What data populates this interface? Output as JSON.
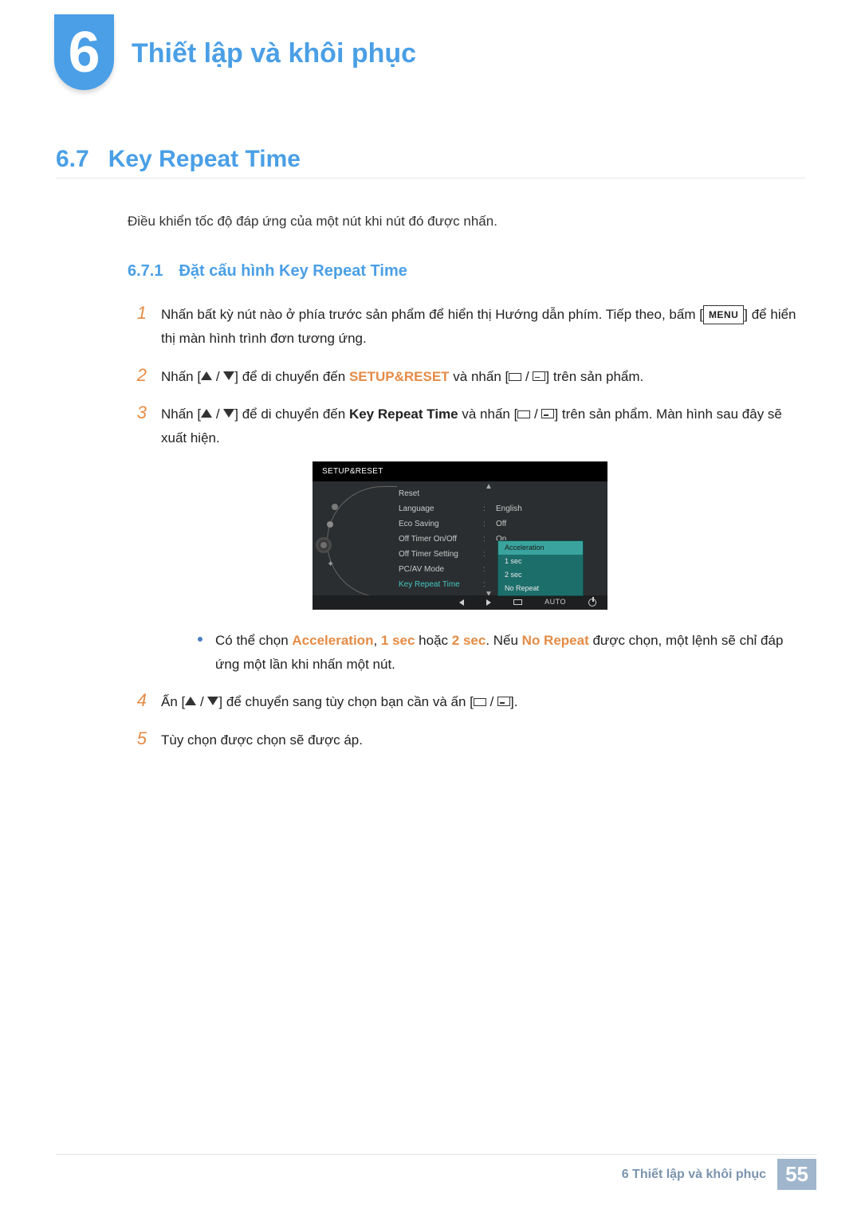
{
  "chapter": {
    "number": "6",
    "title": "Thiết lập và khôi phục"
  },
  "section": {
    "number": "6.7",
    "title": "Key Repeat Time"
  },
  "intro": "Điều khiển tốc độ đáp ứng của một nút khi nút đó được nhấn.",
  "subsection": {
    "number": "6.7.1",
    "title": "Đặt cấu hình Key Repeat Time"
  },
  "steps": {
    "s1": {
      "num": "1",
      "part1": "Nhấn bất kỳ nút nào ở phía trước sản phẩm để hiển thị Hướng dẫn phím. Tiếp theo, bấm [",
      "menu": "MENU",
      "part2": "] để hiển thị màn hình trình đơn tương ứng."
    },
    "s2": {
      "num": "2",
      "pre": "Nhấn [",
      "mid": "] để di chuyển đến ",
      "kw": "SETUP&RESET",
      "post1": " và nhấn [",
      "post2": "] trên sản phẩm."
    },
    "s3": {
      "num": "3",
      "pre": "Nhấn [",
      "mid": "] để di chuyển đến ",
      "kw": "Key Repeat Time",
      "post1": " và nhấn [",
      "post2": "] trên sản phẩm. Màn hình sau đây sẽ xuất hiện."
    },
    "bullet": {
      "t1": "Có thể chọn ",
      "a": "Acceleration",
      "t2": ", ",
      "b": "1 sec",
      "t3": " hoặc ",
      "c": "2 sec",
      "t4": ". Nếu ",
      "d": "No Repeat",
      "t5": " được chọn, một lệnh sẽ chỉ đáp ứng một lần khi nhấn một nút."
    },
    "s4": {
      "num": "4",
      "pre": "Ấn [",
      "mid": "] để chuyển sang tùy chọn bạn cần và ấn [",
      "post": "]."
    },
    "s5": {
      "num": "5",
      "text": "Tùy chọn được chọn sẽ được áp."
    }
  },
  "osd": {
    "title": "SETUP&RESET",
    "rows": {
      "r1": "Reset",
      "r2": "Language",
      "v2": "English",
      "r3": "Eco Saving",
      "v3": "Off",
      "r4": "Off Timer On/Off",
      "v4": "On",
      "r5": "Off Timer Setting",
      "r6": "PC/AV Mode",
      "r7": "Key Repeat Time"
    },
    "popup": {
      "o1": "Acceleration",
      "o2": "1 sec",
      "o3": "2 sec",
      "o4": "No Repeat"
    },
    "auto": "AUTO"
  },
  "footer": {
    "text": "6 Thiết lập và khôi phục",
    "page": "55"
  }
}
